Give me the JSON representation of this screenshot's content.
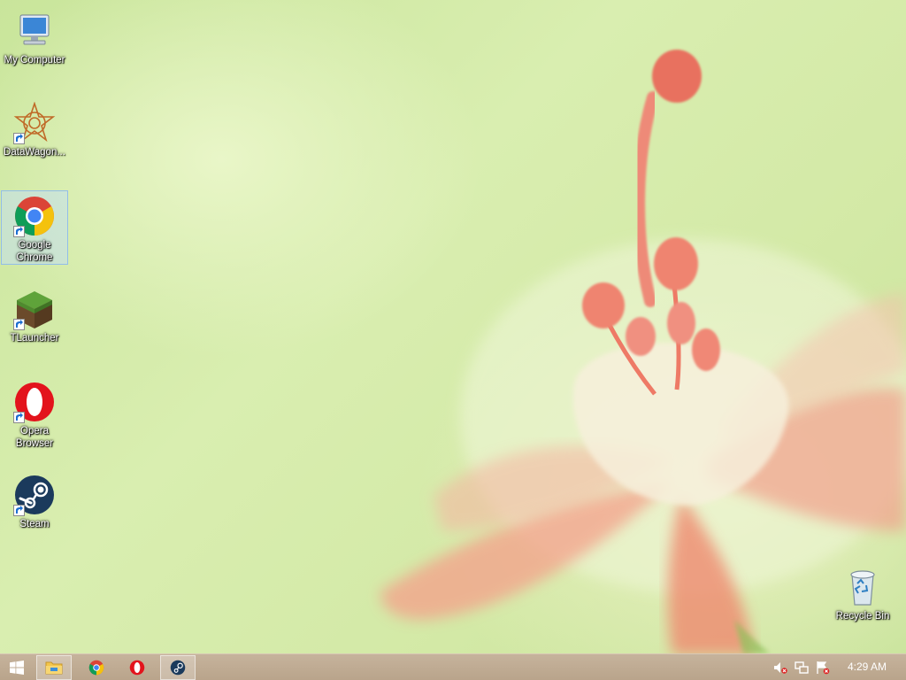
{
  "desktop": {
    "icons": [
      {
        "label": "My Computer",
        "icon": "computer-icon",
        "shortcut": false,
        "selected": false
      },
      {
        "label": "DataWagon...",
        "icon": "datawagon-icon",
        "shortcut": true,
        "selected": false
      },
      {
        "label": "Google Chrome",
        "icon": "chrome-icon",
        "shortcut": true,
        "selected": true
      },
      {
        "label": "TLauncher",
        "icon": "tlauncher-icon",
        "shortcut": true,
        "selected": false
      },
      {
        "label": "Opera Browser",
        "icon": "opera-icon",
        "shortcut": true,
        "selected": false
      },
      {
        "label": "Steam",
        "icon": "steam-icon",
        "shortcut": true,
        "selected": false
      },
      {
        "label": "Recycle Bin",
        "icon": "recycle-bin-icon",
        "shortcut": false,
        "selected": false
      }
    ]
  },
  "taskbar": {
    "pinned": [
      {
        "name": "start",
        "icon": "windows-logo-icon"
      },
      {
        "name": "file-explorer",
        "icon": "folder-icon"
      },
      {
        "name": "chrome",
        "icon": "chrome-icon"
      },
      {
        "name": "opera",
        "icon": "opera-icon"
      },
      {
        "name": "steam",
        "icon": "steam-icon"
      }
    ],
    "tray": {
      "icons": [
        "volume-muted-icon",
        "network-icon",
        "flag-alert-icon"
      ],
      "clock": "4:29 AM"
    }
  },
  "colors": {
    "taskbar": "#bfa98f",
    "selection": "#bedcff",
    "wallpaper_green": "#d3e9a6",
    "flower": "#f08c78"
  }
}
